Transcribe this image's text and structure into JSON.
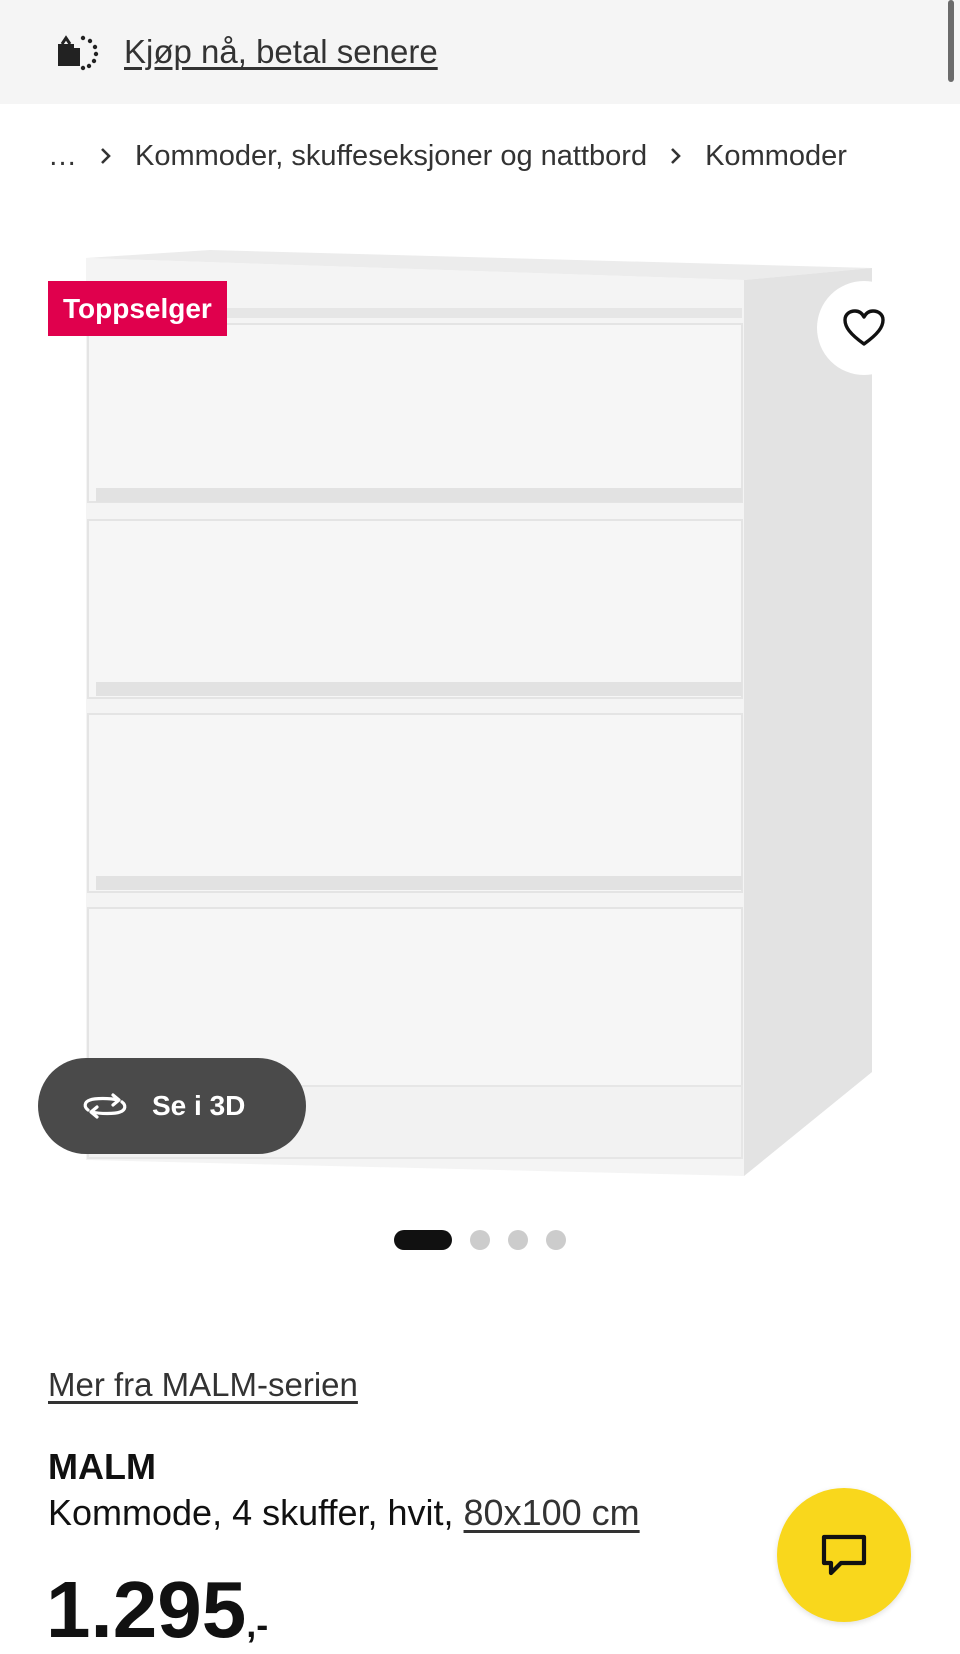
{
  "colors": {
    "promo_background": "#f5f5f5",
    "badge_background": "#e0004d",
    "chat_button": "#f9d71c",
    "view3d_button": "#4a4a4a"
  },
  "promo": {
    "icon": "pay-later-icon",
    "link_text": "Kjøp nå, betal senere"
  },
  "breadcrumb": {
    "items": [
      "…",
      "Kommoder, skuffeseksjoner og nattbord",
      "Kommoder"
    ],
    "separator_icon": "chevron-right-icon"
  },
  "gallery": {
    "badge": "Toppselger",
    "favorite_icon": "heart-icon",
    "view3d_icon": "rotate-3d-icon",
    "view3d_label": "Se i 3D",
    "slide_count": 4,
    "active_slide": 1
  },
  "product": {
    "series_link": "Mer fra MALM-serien",
    "name": "MALM",
    "description": "Kommode, 4 skuffer, hvit, ",
    "size_link": "80x100 cm",
    "price_integer": "1.295",
    "price_suffix": ",-"
  },
  "chat": {
    "icon": "chat-icon"
  }
}
